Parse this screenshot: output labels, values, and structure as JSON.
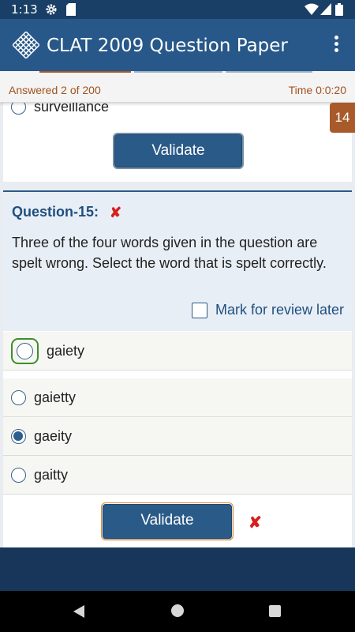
{
  "status_bar": {
    "time": "1:13",
    "icons": [
      "gear-icon",
      "sd-card-icon",
      "wifi-icon",
      "cell-signal-icon",
      "battery-icon"
    ]
  },
  "app_bar": {
    "title": "CLAT 2009 Question Paper",
    "logo": "app-logo-icon",
    "menu_icon": "overflow-menu-icon"
  },
  "progress": {
    "answered": "Answered 2 of 200",
    "timer": "Time 0:0:20"
  },
  "previous_question": {
    "last_option": "surveillance",
    "validate_label": "Validate",
    "badge": "14"
  },
  "question": {
    "title": "Question-15:",
    "status_icon": "cross-icon",
    "text": "Three of the four words given in the question are spelt wrong. Select the word that is spelt correctly.",
    "review_label": "Mark for review later",
    "review_checked": false,
    "options": [
      {
        "label": "gaiety",
        "state": "focused"
      },
      {
        "label": "gaietty",
        "state": "unselected"
      },
      {
        "label": "gaeity",
        "state": "selected"
      },
      {
        "label": "gaitty",
        "state": "unselected"
      }
    ],
    "validate_label": "Validate",
    "result_icon": "cross-icon"
  },
  "colors": {
    "app_bar": "#275889",
    "status_bar": "#1a3f66",
    "accent_orange": "#a0521d",
    "wrong_red": "#d61f1f",
    "focus_green": "#3f8e2e"
  },
  "nav_bar": {
    "icons": [
      "back-icon",
      "home-icon",
      "recents-icon"
    ]
  }
}
